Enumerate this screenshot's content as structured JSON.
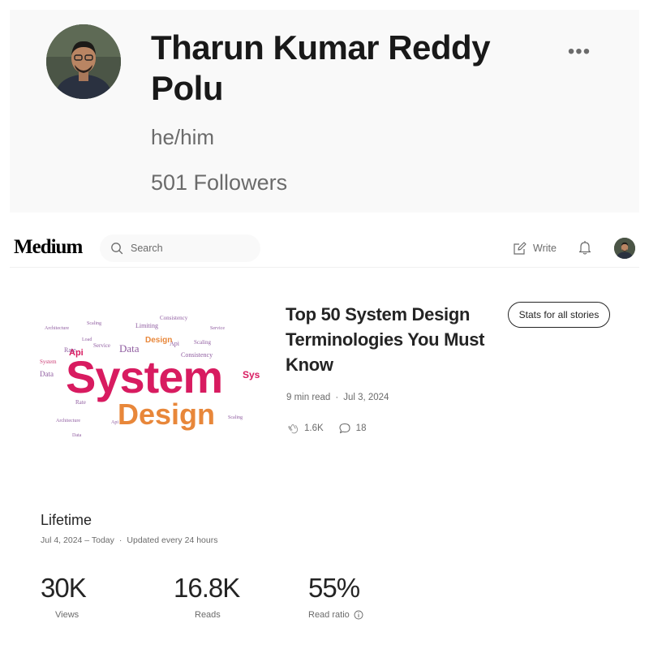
{
  "profile": {
    "name": "Tharun Kumar Reddy Polu",
    "pronouns": "he/him",
    "followers": "501 Followers",
    "more_label": "•••"
  },
  "header": {
    "logo": "Medium",
    "search_placeholder": "Search",
    "write_label": "Write"
  },
  "story": {
    "title": "Top 50 System Design Terminologies You Must Know",
    "stats_button": "Stats for all stories",
    "read_time": "9 min read",
    "separator": "·",
    "date": "Jul 3, 2024",
    "claps": "1.6K",
    "responses": "18",
    "thumbnail": {
      "word_main": "System",
      "word_sub": "Design",
      "cloud_words": [
        "Architecture",
        "Scaling",
        "Limiting",
        "Design",
        "Api",
        "Data",
        "Consistency",
        "Rate",
        "Service",
        "Load",
        "Data",
        "Sys",
        "System",
        "Rate",
        "Api",
        "Architecture"
      ]
    }
  },
  "lifetime": {
    "title": "Lifetime",
    "range": "Jul 4, 2024 – Today",
    "separator": "·",
    "updated": "Updated every 24 hours",
    "stats": [
      {
        "value": "30K",
        "label": "Views"
      },
      {
        "value": "16.8K",
        "label": "Reads"
      },
      {
        "value": "55%",
        "label": "Read ratio"
      }
    ]
  },
  "colors": {
    "text": "#242424",
    "muted": "#6b6b6b",
    "thumb_pink": "#d81b60",
    "thumb_orange": "#e8873a",
    "thumb_purple": "#7b3f8f"
  }
}
